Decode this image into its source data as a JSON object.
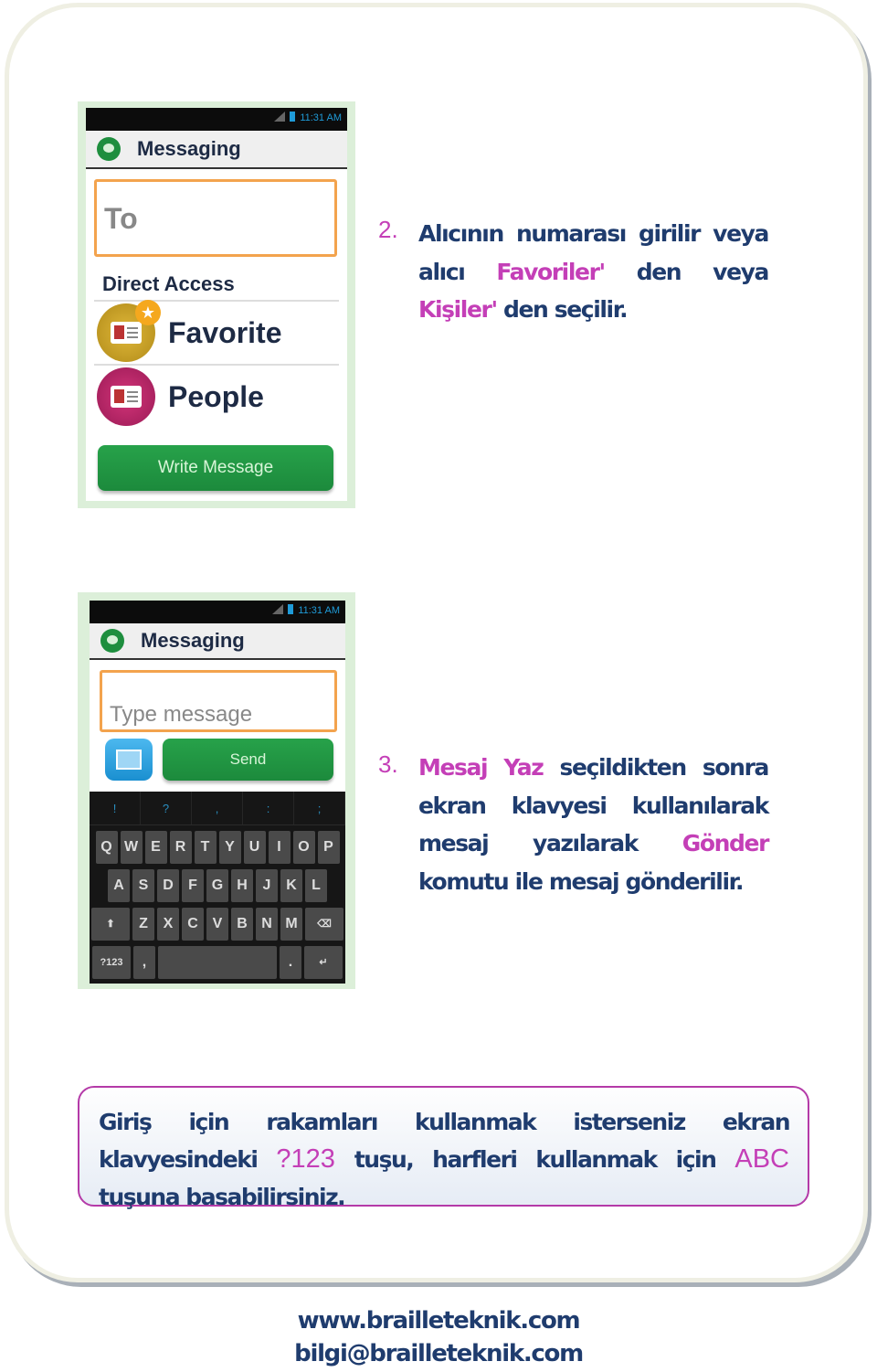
{
  "colors": {
    "text": "#1f3c6e",
    "accent": "#c43fb7",
    "button_green": "#1c8a3c",
    "field_border": "#f3a34d"
  },
  "phone1": {
    "time": "11:31 AM",
    "app_title": "Messaging",
    "to_placeholder": "To",
    "section": "Direct Access",
    "items": [
      {
        "label": "Favorite",
        "icon": "favorite-contact-icon"
      },
      {
        "label": "People",
        "icon": "people-contact-icon"
      }
    ],
    "button": "Write Message"
  },
  "phone2": {
    "time": "11:31 AM",
    "app_title": "Messaging",
    "message_placeholder": "Type message",
    "send": "Send",
    "keyboard": {
      "symbols": [
        "!",
        "?",
        ",",
        ":",
        ";"
      ],
      "row1": [
        "Q",
        "W",
        "E",
        "R",
        "T",
        "Y",
        "U",
        "I",
        "O",
        "P"
      ],
      "row2": [
        "A",
        "S",
        "D",
        "F",
        "G",
        "H",
        "J",
        "K",
        "L"
      ],
      "row3": [
        "Z",
        "X",
        "C",
        "V",
        "B",
        "N",
        "M"
      ],
      "numkey": "?123",
      "comma": ",",
      "period": "."
    }
  },
  "step2": {
    "number": "2.",
    "t1": "Alıcının numarası girilir veya alıcı ",
    "h1": "Favoriler'",
    "t2": " den veya ",
    "h2": "Kişiler'",
    "t3": " den seçilir."
  },
  "step3": {
    "number": "3.",
    "h1": "Mesaj Yaz",
    "t1": " seçildikten sonra ekran klavyesi kullanılarak mesaj yazılarak ",
    "h2": "Gönder",
    "t2": " komutu ile mesaj gönderilir."
  },
  "note": {
    "t1": "Giriş için rakamları kullanmak isterseniz ekran klavyesindeki ",
    "h1": "?123",
    "t2": " tuşu, harfleri kullanmak için ",
    "h2": "ABC",
    "t3": " tuşuna basabilirsiniz."
  },
  "footer": {
    "website": "www.brailleteknik.com",
    "email": "bilgi@brailleteknik.com"
  }
}
